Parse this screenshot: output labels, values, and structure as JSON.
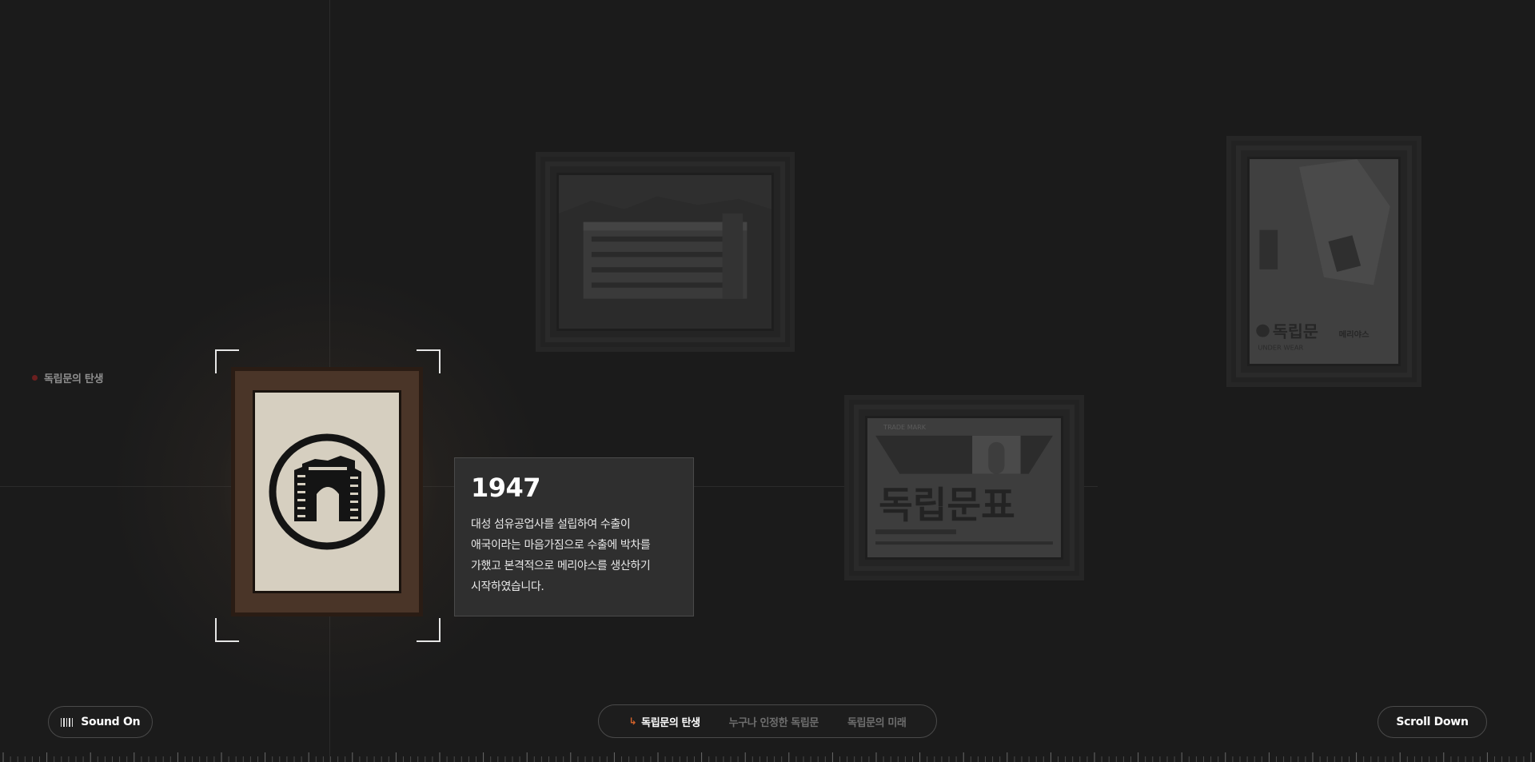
{
  "section_label": "독립문의 탄생",
  "info": {
    "year": "1947",
    "lines": [
      "대성 섬유공업사를 설립하여 수출이",
      "애국이라는 마음가짐으로 수출에 박차를",
      "가했고 본격적으로 메리야스를 생산하기",
      "시작하였습니다."
    ]
  },
  "images": {
    "poster_brand": "독립문",
    "poster_sub": "메리야스",
    "poster_en": "UNDER WEAR",
    "label_trade_mark": "TRADE MARK",
    "label_title": "독립문표"
  },
  "controls": {
    "sound_label": "Sound On",
    "scroll_label": "Scroll Down"
  },
  "nav": {
    "items": [
      "독립문의 탄생",
      "누구나 인정한 독립문",
      "독립문의 미래"
    ],
    "active_index": 0
  },
  "colors": {
    "background": "#1b1b1b",
    "accent": "#d4632b",
    "section_dot": "#6b1f1f"
  },
  "icons": [
    "sound-bars-icon",
    "arrow-return-icon",
    "independence-gate-logo"
  ]
}
